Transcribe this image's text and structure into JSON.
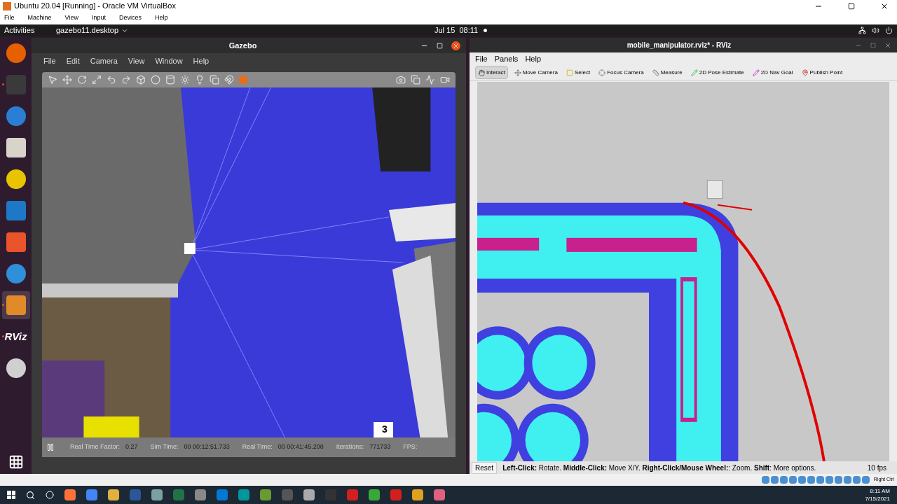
{
  "vbox": {
    "title": "Ubuntu 20.04 [Running] - Oracle VM VirtualBox",
    "menu": [
      "File",
      "Machine",
      "View",
      "Input",
      "Devices",
      "Help"
    ],
    "host_key": "Right Ctrl"
  },
  "top_bar": {
    "activities": "Activities",
    "app_menu": "gazebo11.desktop",
    "clock": "Jul 15  08:11"
  },
  "dock": [
    {
      "kind": "firefox",
      "running": false,
      "selected": false
    },
    {
      "kind": "terminal",
      "running": true,
      "selected": false
    },
    {
      "kind": "mail",
      "running": false,
      "selected": false
    },
    {
      "kind": "files",
      "running": false,
      "selected": false
    },
    {
      "kind": "music",
      "running": false,
      "selected": false
    },
    {
      "kind": "writer",
      "running": false,
      "selected": false
    },
    {
      "kind": "store",
      "running": false,
      "selected": false
    },
    {
      "kind": "help",
      "running": false,
      "selected": false
    },
    {
      "kind": "gazebo",
      "running": true,
      "selected": true
    },
    {
      "kind": "rviz",
      "label": "RViz",
      "running": true,
      "selected": false
    },
    {
      "kind": "disc",
      "running": false,
      "selected": false
    }
  ],
  "gazebo": {
    "title": "Gazebo",
    "menu": [
      "File",
      "Edit",
      "Camera",
      "View",
      "Window",
      "Help"
    ],
    "status": [
      {
        "label": "Real Time Factor:",
        "value": "0.27"
      },
      {
        "label": "Sim Time:",
        "value": "00 00:12:51.733"
      },
      {
        "label": "Real Time:",
        "value": "00 00:41:45.208"
      },
      {
        "label": "Iterations:",
        "value": "771733"
      },
      {
        "label": "FPS:"
      }
    ],
    "marker": "3"
  },
  "rviz": {
    "title": "mobile_manipulator.rviz* - RViz",
    "menu": [
      "File",
      "Panels",
      "Help"
    ],
    "tools": [
      {
        "label": "Interact",
        "selected": true
      },
      {
        "label": "Move Camera",
        "selected": false
      },
      {
        "label": "Select",
        "selected": false
      },
      {
        "label": "Focus Camera",
        "selected": false
      },
      {
        "label": "Measure",
        "selected": false
      },
      {
        "label": "2D Pose Estimate",
        "selected": false
      },
      {
        "label": "2D Nav Goal",
        "selected": false
      },
      {
        "label": "Publish Point",
        "selected": false
      }
    ],
    "reset": "Reset",
    "help": "**Left-Click:** Rotate. **Middle-Click:** Move X/Y. **Right-Click/Mouse Wheel:**: Zoom. **Shift**: More options.",
    "fps": "10 fps"
  },
  "taskbar": {
    "time": "8:11 AM",
    "date": "7/15/2021"
  }
}
